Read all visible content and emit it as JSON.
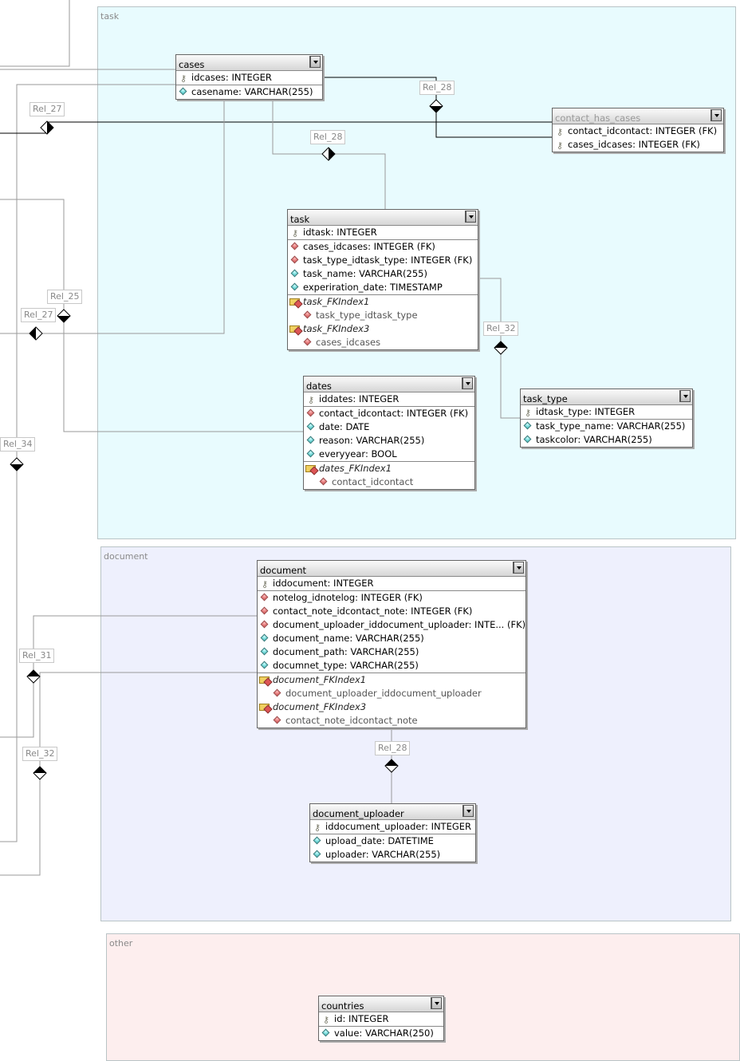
{
  "regions": [
    {
      "label": "task",
      "color": "#e8fbfe"
    },
    {
      "label": "document",
      "color": "#eef0fd"
    },
    {
      "label": "other",
      "color": "#fdeeee"
    }
  ],
  "tables": [
    {
      "name": "cases",
      "dim": false,
      "columns": [
        {
          "text": "idcases: INTEGER",
          "kind": "pk"
        },
        {
          "text": "casename: VARCHAR(255)",
          "kind": "attr"
        }
      ],
      "indices": []
    },
    {
      "name": "contact_has_cases",
      "dim": true,
      "columns": [
        {
          "text": "contact_idcontact: INTEGER (FK)",
          "kind": "pk"
        },
        {
          "text": "cases_idcases: INTEGER (FK)",
          "kind": "pk"
        }
      ],
      "indices": []
    },
    {
      "name": "task",
      "dim": false,
      "columns": [
        {
          "text": "idtask: INTEGER",
          "kind": "pk"
        },
        {
          "text": "cases_idcases: INTEGER (FK)",
          "kind": "fk"
        },
        {
          "text": "task_type_idtask_type: INTEGER (FK)",
          "kind": "fk"
        },
        {
          "text": "task_name: VARCHAR(255)",
          "kind": "attr"
        },
        {
          "text": "experiration_date: TIMESTAMP",
          "kind": "attr"
        }
      ],
      "indices": [
        {
          "name": "task_FKIndex1",
          "columns": [
            "task_type_idtask_type"
          ]
        },
        {
          "name": "task_FKIndex3",
          "columns": [
            "cases_idcases"
          ]
        }
      ]
    },
    {
      "name": "dates",
      "dim": false,
      "columns": [
        {
          "text": "iddates: INTEGER",
          "kind": "pk"
        },
        {
          "text": "contact_idcontact: INTEGER (FK)",
          "kind": "fk"
        },
        {
          "text": "date: DATE",
          "kind": "attr"
        },
        {
          "text": "reason: VARCHAR(255)",
          "kind": "attr"
        },
        {
          "text": "everyyear: BOOL",
          "kind": "attr"
        }
      ],
      "indices": [
        {
          "name": "dates_FKIndex1",
          "columns": [
            "contact_idcontact"
          ]
        }
      ]
    },
    {
      "name": "task_type",
      "dim": false,
      "columns": [
        {
          "text": "idtask_type: INTEGER",
          "kind": "pk"
        },
        {
          "text": "task_type_name: VARCHAR(255)",
          "kind": "attr"
        },
        {
          "text": "taskcolor: VARCHAR(255)",
          "kind": "attr"
        }
      ],
      "indices": []
    },
    {
      "name": "document",
      "dim": false,
      "columns": [
        {
          "text": "iddocument: INTEGER",
          "kind": "pk"
        },
        {
          "text": "notelog_idnotelog: INTEGER (FK)",
          "kind": "fk"
        },
        {
          "text": "contact_note_idcontact_note: INTEGER (FK)",
          "kind": "fk"
        },
        {
          "text": "document_uploader_iddocument_uploader: INTE... (FK)",
          "kind": "fk"
        },
        {
          "text": "document_name: VARCHAR(255)",
          "kind": "attr"
        },
        {
          "text": "document_path: VARCHAR(255)",
          "kind": "attr"
        },
        {
          "text": "documnet_type: VARCHAR(255)",
          "kind": "attr"
        }
      ],
      "indices": [
        {
          "name": "document_FKIndex1",
          "columns": [
            "document_uploader_iddocument_uploader"
          ]
        },
        {
          "name": "document_FKIndex3",
          "columns": [
            "contact_note_idcontact_note"
          ]
        }
      ]
    },
    {
      "name": "document_uploader",
      "dim": false,
      "columns": [
        {
          "text": "iddocument_uploader: INTEGER",
          "kind": "pk"
        },
        {
          "text": "upload_date: DATETIME",
          "kind": "attr"
        },
        {
          "text": "uploader: VARCHAR(255)",
          "kind": "attr"
        }
      ],
      "indices": []
    },
    {
      "name": "countries",
      "dim": false,
      "columns": [
        {
          "text": "id: INTEGER",
          "kind": "pk"
        },
        {
          "text": "value: VARCHAR(250)",
          "kind": "attr"
        }
      ],
      "indices": []
    }
  ],
  "relations": [
    "Rel_27",
    "Rel_28",
    "Rel_28",
    "Rel_25",
    "Rel_27",
    "Rel_32",
    "Rel_34",
    "Rel_31",
    "Rel_32",
    "Rel_28"
  ]
}
